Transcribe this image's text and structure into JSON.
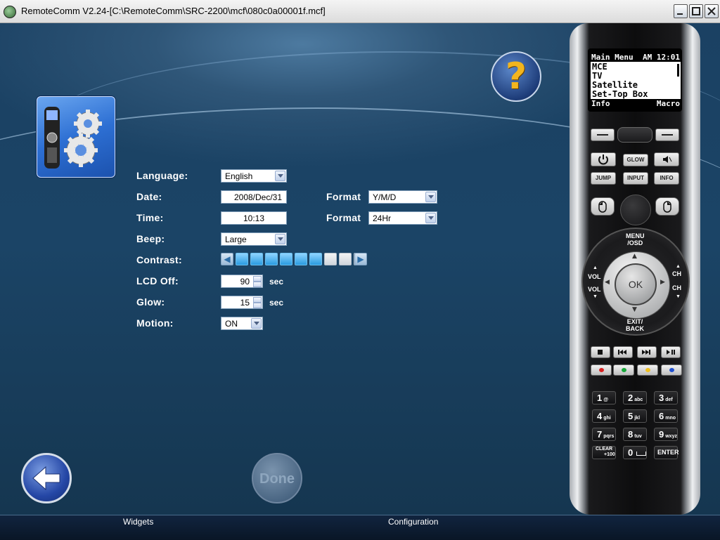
{
  "window": {
    "title": "RemoteComm V2.24-[C:\\RemoteComm\\SRC-2200\\mcf\\080c0a00001f.mcf]"
  },
  "help": {
    "glyph": "?"
  },
  "form": {
    "language": {
      "label": "Language:",
      "value": "English"
    },
    "date": {
      "label": "Date:",
      "value": "2008/Dec/31",
      "format_label": "Format",
      "format_value": "Y/M/D"
    },
    "time": {
      "label": "Time:",
      "value": "10:13",
      "format_label": "Format",
      "format_value": "24Hr"
    },
    "beep": {
      "label": "Beep:",
      "value": "Large"
    },
    "contrast": {
      "label": "Contrast:",
      "level": 6,
      "max": 9
    },
    "lcd_off": {
      "label": "LCD Off:",
      "value": "90",
      "unit": "sec"
    },
    "glow": {
      "label": "Glow:",
      "value": "15",
      "unit": "sec"
    },
    "motion": {
      "label": "Motion:",
      "value": "ON"
    }
  },
  "buttons": {
    "done": "Done"
  },
  "bottom_tabs": {
    "widgets": "Widgets",
    "configuration": "Configuration"
  },
  "remote": {
    "lcd": {
      "header_left": "Main Menu",
      "header_right": "AM 12:01",
      "items": [
        "MCE",
        "TV",
        "Satellite",
        "Set-Top Box"
      ],
      "footer_left": "Info",
      "footer_right": "Macro"
    },
    "keys": {
      "glow": "GLOW",
      "jump": "JUMP",
      "input": "INPUT",
      "info": "INFO",
      "menu_osd": "MENU\n/OSD",
      "exit_back": "EXIT/\nBACK",
      "ok": "OK",
      "vol": "VOL",
      "ch": "CH",
      "clear": "CLEAR",
      "clear_sub": "+100",
      "enter": "ENTER"
    },
    "numpad": [
      {
        "n": "1",
        "s": "@"
      },
      {
        "n": "2",
        "s": "abc"
      },
      {
        "n": "3",
        "s": "def"
      },
      {
        "n": "4",
        "s": "ghi"
      },
      {
        "n": "5",
        "s": "jkl"
      },
      {
        "n": "6",
        "s": "mno"
      },
      {
        "n": "7",
        "s": "pqrs"
      },
      {
        "n": "8",
        "s": "tuv"
      },
      {
        "n": "9",
        "s": "wxyz"
      }
    ],
    "zero": "0",
    "color_keys": [
      "#d62020",
      "#18a83a",
      "#f0c020",
      "#2050d0"
    ]
  }
}
